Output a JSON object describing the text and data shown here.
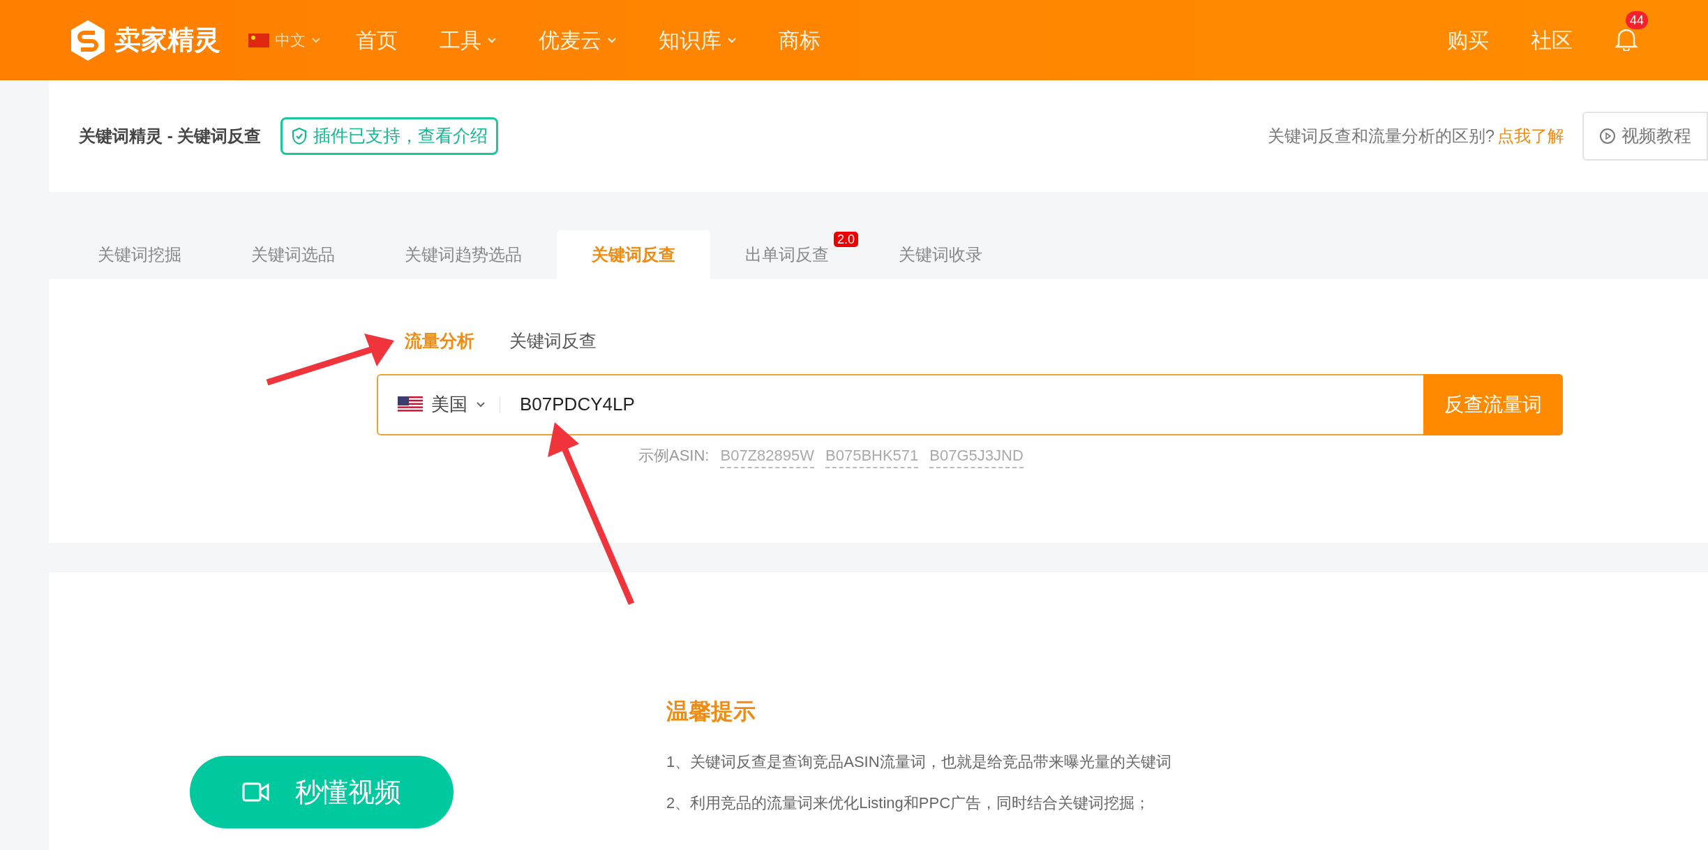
{
  "header": {
    "logo": "卖家精灵",
    "language": "中文",
    "nav": [
      {
        "label": "首页",
        "dropdown": false
      },
      {
        "label": "工具",
        "dropdown": true
      },
      {
        "label": "优麦云",
        "dropdown": true
      },
      {
        "label": "知识库",
        "dropdown": true
      },
      {
        "label": "商标",
        "dropdown": false
      }
    ],
    "right_links": [
      "购买",
      "社区"
    ],
    "notification_count": "44"
  },
  "title_bar": {
    "title": "关键词精灵 - 关键词反查",
    "plugin_badge": "插件已支持，查看介绍",
    "question": "关键词反查和流量分析的区别?",
    "question_link": "点我了解",
    "video_button": "视频教程"
  },
  "tabs": [
    {
      "label": "关键词挖掘",
      "selected": false
    },
    {
      "label": "关键词选品",
      "selected": false
    },
    {
      "label": "关键词趋势选品",
      "selected": false
    },
    {
      "label": "关键词反查",
      "selected": true
    },
    {
      "label": "出单词反查",
      "selected": false,
      "badge": "2.0"
    },
    {
      "label": "关键词收录",
      "selected": false
    }
  ],
  "sub_tabs": [
    {
      "label": "流量分析",
      "selected": true
    },
    {
      "label": "关键词反查",
      "selected": false
    }
  ],
  "search": {
    "country": "美国",
    "value": "B07PDCY4LP",
    "button": "反查流量词"
  },
  "examples": {
    "label": "示例ASIN:",
    "asins": [
      "B07Z82895W",
      "B075BHK571",
      "B07G5J3JND"
    ]
  },
  "tips": {
    "title": "温馨提示",
    "lines": [
      "1、关键词反查是查询竞品ASIN流量词，也就是给竞品带来曝光量的关键词",
      "2、利用竞品的流量词来优化Listing和PPC广告，同时结合关键词挖掘；"
    ]
  },
  "video_cta": "秒懂视频"
}
